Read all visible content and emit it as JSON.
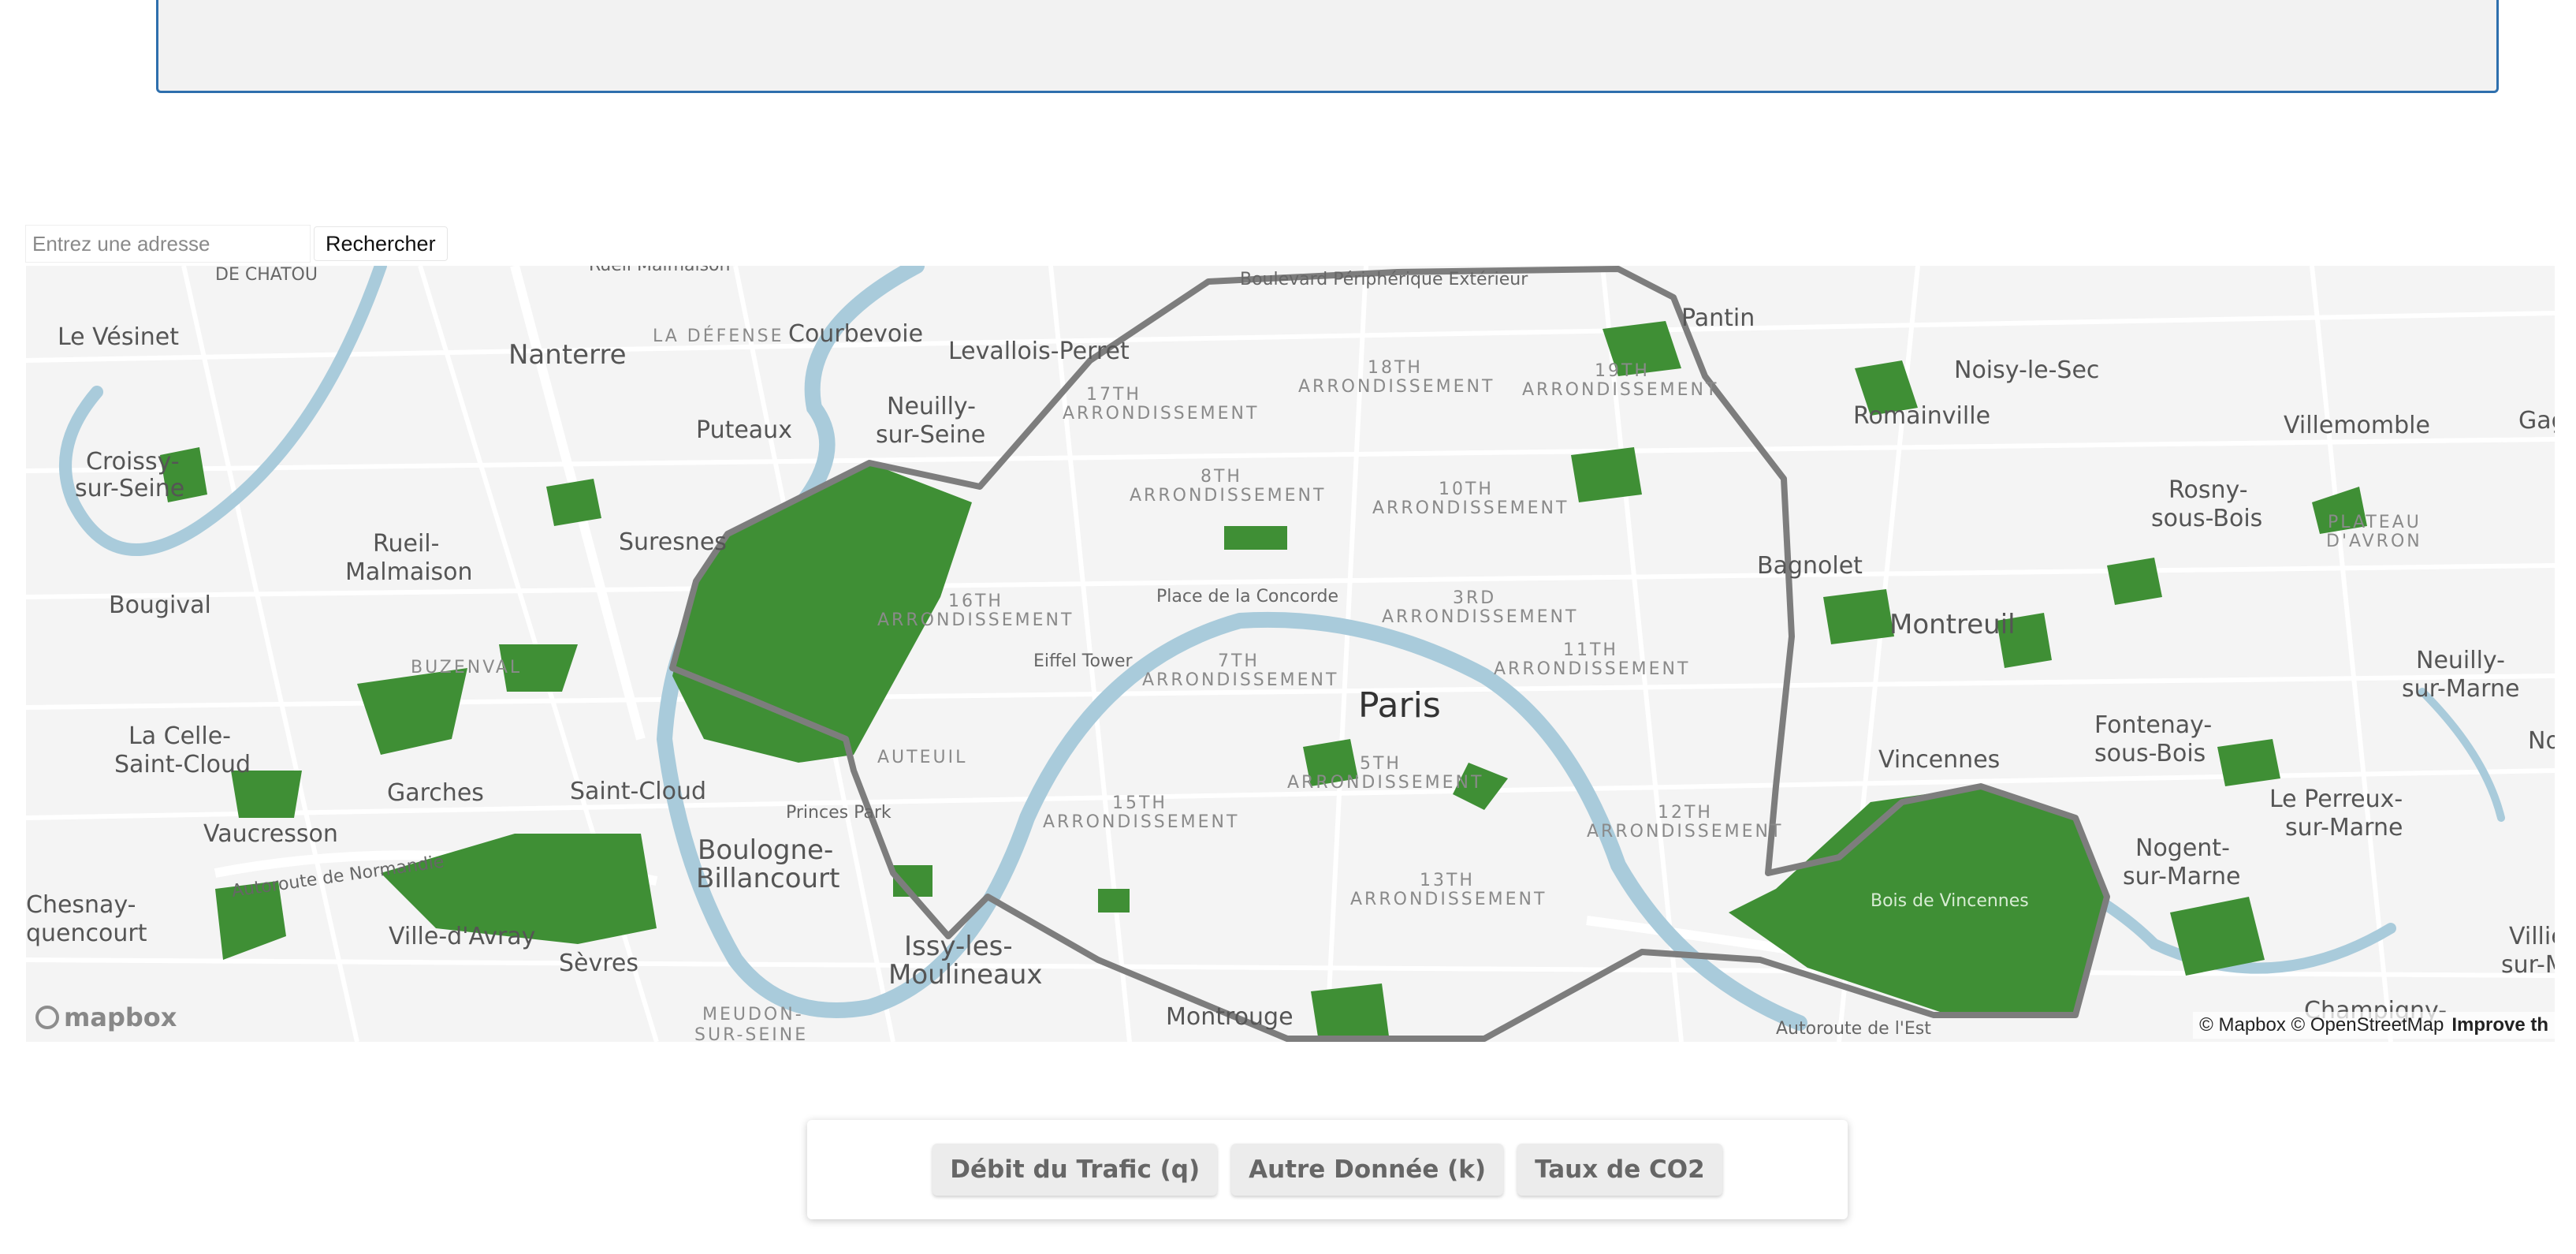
{
  "search": {
    "placeholder": "Entrez une adresse",
    "button_label": "Rechercher"
  },
  "map": {
    "labels": {
      "nanterre": "Nanterre",
      "courbevoie": "Courbevoie",
      "levallois": "Levallois-Perret",
      "neuilly_line1": "Neuilly-",
      "neuilly_line2": "sur-Seine",
      "puteaux": "Puteaux",
      "la_defense": "LA DÉFENSE",
      "le_vesinet": "Le Vésinet",
      "croissy_line1": "Croissy-",
      "croissy_line2": "sur-Seine",
      "rueil_line1": "Rueil-",
      "rueil_line2": "Malmaison",
      "suresnes": "Suresnes",
      "bougival": "Bougival",
      "buzenval": "BUZENVAL",
      "la_celle_line1": "La Celle-",
      "la_celle_line2": "Saint-Cloud",
      "garches": "Garches",
      "saint_cloud": "Saint-Cloud",
      "vaucresson": "Vaucresson",
      "chesnay_line1": "Chesnay-",
      "chesnay_line2": "quencourt",
      "ville_davray": "Ville-d'Avray",
      "sevres": "Sèvres",
      "boulogne_line1": "Boulogne-",
      "boulogne_line2": "Billancourt",
      "princes_park": "Princes Park",
      "issy_line1": "Issy-les-",
      "issy_line2": "Moulineaux",
      "meudon_line1": "MEUDON-",
      "meudon_line2": "SUR-SEINE",
      "montrouge": "Montrouge",
      "paris": "Paris",
      "eiffel_tower": "Eiffel Tower",
      "concorde": "Place de la Concorde",
      "auteuil": "AUTEUIL",
      "arr_17_line1": "17TH",
      "arr_17_line2": "ARRONDISSEMENT",
      "arr_18_line1": "18TH",
      "arr_18_line2": "ARRONDISSEMENT",
      "arr_19_line1": "19TH",
      "arr_19_line2": "ARRONDISSEMENT",
      "arr_8_line1": "8TH",
      "arr_8_line2": "ARRONDISSEMENT",
      "arr_10_line1": "10TH",
      "arr_10_line2": "ARRONDISSEMENT",
      "arr_16_line1": "16TH",
      "arr_16_line2": "ARRONDISSEMENT",
      "arr_7_line1": "7TH",
      "arr_7_line2": "ARRONDISSEMENT",
      "arr_3_line1": "3RD",
      "arr_3_line2": "ARRONDISSEMENT",
      "arr_11_line1": "11TH",
      "arr_11_line2": "ARRONDISSEMENT",
      "arr_5_line1": "5TH",
      "arr_5_line2": "ARRONDISSEMENT",
      "arr_15_line1": "15TH",
      "arr_15_line2": "ARRONDISSEMENT",
      "arr_12_line1": "12TH",
      "arr_12_line2": "ARRONDISSEMENT",
      "arr_13_line1": "13TH",
      "arr_13_line2": "ARRONDISSEMENT",
      "pantin": "Pantin",
      "noisy": "Noisy-le-Sec",
      "romainville": "Romainville",
      "villemomble": "Villemomble",
      "gagny": "Gagny",
      "rosny_line1": "Rosny-",
      "rosny_line2": "sous-Bois",
      "plateau_line1": "PLATEAU",
      "plateau_line2": "D'AVRON",
      "bagnolet": "Bagnolet",
      "montreuil": "Montreuil",
      "neuilly_marne_line1": "Neuilly-",
      "neuilly_marne_line2": "sur-Marne",
      "fontenay_line1": "Fontenay-",
      "fontenay_line2": "sous-Bois",
      "vincennes": "Vincennes",
      "le_perreux_line1": "Le Perreux-",
      "le_perreux_line2": "sur-Marne",
      "nogent_line1": "Nogent-",
      "nogent_line2": "sur-Marne",
      "bois_vincennes": "Bois de Vincennes",
      "champigny": "Champigny-",
      "villiers_line1": "Villier",
      "villiers_line2": "sur-Ma",
      "noi": "Noi",
      "boulevard_peripherique": "Boulevard Périphérique Extérieur",
      "autoroute_normandie": "Autoroute de Normandie",
      "autoroute_est": "Autoroute de l'Est",
      "rueil_top": "Rueil Malmaison",
      "chatou_top": "DE CHATOU"
    },
    "logo_text": "mapbox",
    "attribution": "© Mapbox © OpenStreetMap",
    "improve_link": "Improve th"
  },
  "metrics": {
    "traffic": "Débit du Trafic (q)",
    "other": "Autre Donnée (k)",
    "co2": "Taux de CO2"
  },
  "colors": {
    "park_green": "#3f8f35",
    "river_blue": "#a9cbdb",
    "boundary_gray": "#7d7d7d",
    "panel_border": "#2e6fad"
  }
}
